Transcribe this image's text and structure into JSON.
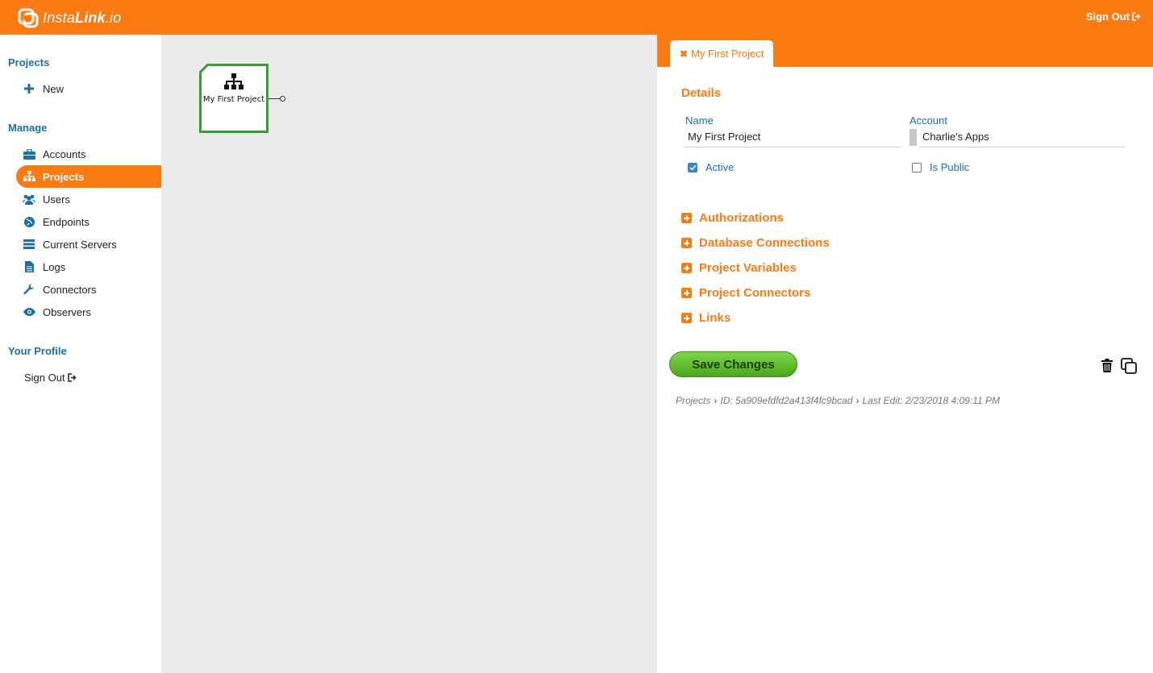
{
  "header": {
    "logo_text_light": "Insta",
    "logo_text_bold": "Link",
    "logo_text_suffix": ".io",
    "signout_label": "Sign Out",
    "accent_color": "#fb7a12"
  },
  "sidebar": {
    "projects_heading": "Projects",
    "new_label": "New",
    "manage_heading": "Manage",
    "items": [
      {
        "label": "Accounts",
        "icon": "briefcase-icon"
      },
      {
        "label": "Projects",
        "icon": "sitemap-icon",
        "active": true
      },
      {
        "label": "Users",
        "icon": "users-icon"
      },
      {
        "label": "Endpoints",
        "icon": "globe-icon"
      },
      {
        "label": "Current Servers",
        "icon": "server-icon"
      },
      {
        "label": "Logs",
        "icon": "document-icon"
      },
      {
        "label": "Connectors",
        "icon": "wrench-icon"
      },
      {
        "label": "Observers",
        "icon": "eye-icon"
      }
    ],
    "profile_heading": "Your Profile",
    "signout_label": "Sign Out"
  },
  "canvas": {
    "node_label": "My First Project"
  },
  "panel": {
    "tab_label": "My First Project",
    "details_title": "Details",
    "name_label": "Name",
    "name_value": "My First Project",
    "account_label": "Account",
    "account_value": "Charlie's Apps",
    "active_label": "Active",
    "active_checked": true,
    "public_label": "Is Public",
    "public_checked": false,
    "sections": [
      "Authorizations",
      "Database Connections",
      "Project Variables",
      "Project Connectors",
      "Links"
    ],
    "save_label": "Save Changes",
    "breadcrumb": {
      "root": "Projects",
      "id": "ID: 5a909efdfd2a413f4fc9bcad",
      "last_edit": "Last Edit: 2/23/2018 4:09:11 PM"
    }
  }
}
